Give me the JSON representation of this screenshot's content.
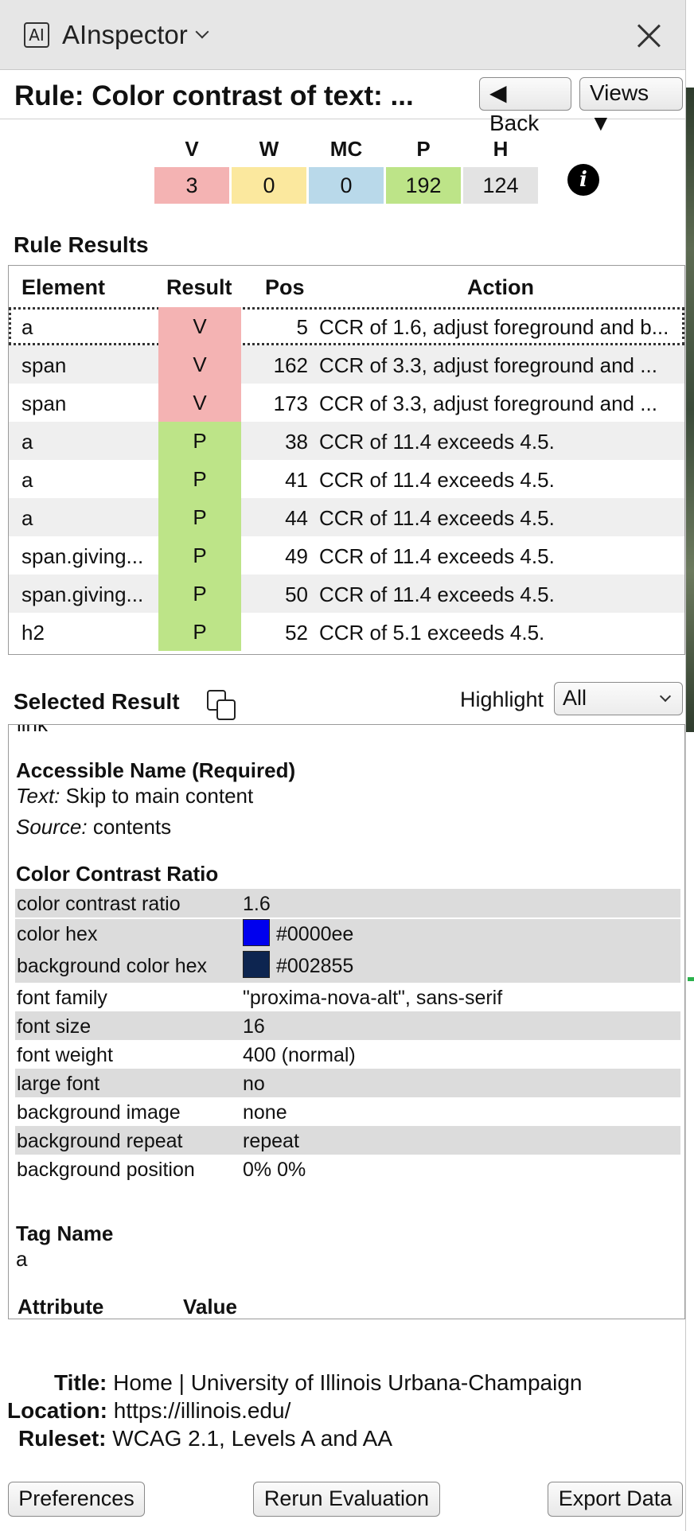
{
  "app": {
    "logo_text": "AI",
    "title": "AInspector"
  },
  "header": {
    "rule_title": "Rule: Color contrast of text: ...",
    "back_label": "◀ Back",
    "views_label": "Views ▼"
  },
  "summary": {
    "items": [
      {
        "label": "V",
        "value": "3",
        "color": "#f4b3b3"
      },
      {
        "label": "W",
        "value": "0",
        "color": "#fbe89e"
      },
      {
        "label": "MC",
        "value": "0",
        "color": "#b9d9ea"
      },
      {
        "label": "P",
        "value": "192",
        "color": "#bde488"
      },
      {
        "label": "H",
        "value": "124",
        "color": "#e3e3e3"
      }
    ],
    "info_icon": "info-icon"
  },
  "rule_results": {
    "heading": "Rule Results",
    "columns": [
      "Element",
      "Result",
      "Pos",
      "Action"
    ],
    "rows": [
      {
        "element": "a",
        "result": "V",
        "pos": "5",
        "action": "CCR of 1.6, adjust foreground and b..."
      },
      {
        "element": "span",
        "result": "V",
        "pos": "162",
        "action": "CCR of 3.3, adjust foreground and ..."
      },
      {
        "element": "span",
        "result": "V",
        "pos": "173",
        "action": "CCR of 3.3, adjust foreground and ..."
      },
      {
        "element": "a",
        "result": "P",
        "pos": "38",
        "action": "CCR of 11.4 exceeds 4.5."
      },
      {
        "element": "a",
        "result": "P",
        "pos": "41",
        "action": "CCR of 11.4 exceeds 4.5."
      },
      {
        "element": "a",
        "result": "P",
        "pos": "44",
        "action": "CCR of 11.4 exceeds 4.5."
      },
      {
        "element": "span.giving...",
        "result": "P",
        "pos": "49",
        "action": "CCR of 11.4 exceeds 4.5."
      },
      {
        "element": "span.giving...",
        "result": "P",
        "pos": "50",
        "action": "CCR of 11.4 exceeds 4.5."
      },
      {
        "element": "h2",
        "result": "P",
        "pos": "52",
        "action": "CCR of 5.1 exceeds 4.5."
      }
    ],
    "result_colors": {
      "V": "#f4b3b3",
      "P": "#bde488"
    }
  },
  "selected_result": {
    "heading": "Selected Result",
    "highlight_label": "Highlight",
    "highlight_value": "All",
    "cut_text": "link",
    "accessible_name_heading": "Accessible Name (Required)",
    "text_label": "Text:",
    "text_value": "Skip to main content",
    "source_label": "Source:",
    "source_value": "contents",
    "ccr_heading": "Color Contrast Ratio",
    "properties": [
      {
        "key": "color contrast ratio",
        "value": "1.6"
      },
      {
        "key": "color hex",
        "value": "#0000ee",
        "swatch": "#0000ee"
      },
      {
        "key": "background color hex",
        "value": "#002855",
        "swatch": "#0d2550"
      },
      {
        "key": "font family",
        "value": "\"proxima-nova-alt\", sans-serif"
      },
      {
        "key": "font size",
        "value": "16"
      },
      {
        "key": "font weight",
        "value": "400 (normal)"
      },
      {
        "key": "large font",
        "value": "no"
      },
      {
        "key": "background image",
        "value": "none"
      },
      {
        "key": "background repeat",
        "value": "repeat"
      },
      {
        "key": "background position",
        "value": "0% 0%"
      }
    ],
    "tag_name_heading": "Tag Name",
    "tag_name_value": "a",
    "attr_col_attribute": "Attribute",
    "attr_col_value": "Value"
  },
  "page_info": {
    "title_label": "Title:",
    "title_value": "Home | University of Illinois Urbana-Champaign",
    "location_label": "Location:",
    "location_value": "https://illinois.edu/",
    "ruleset_label": "Ruleset:",
    "ruleset_value": "WCAG 2.1, Levels A and AA"
  },
  "footer": {
    "preferences": "Preferences",
    "rerun": "Rerun Evaluation",
    "export": "Export Data"
  }
}
